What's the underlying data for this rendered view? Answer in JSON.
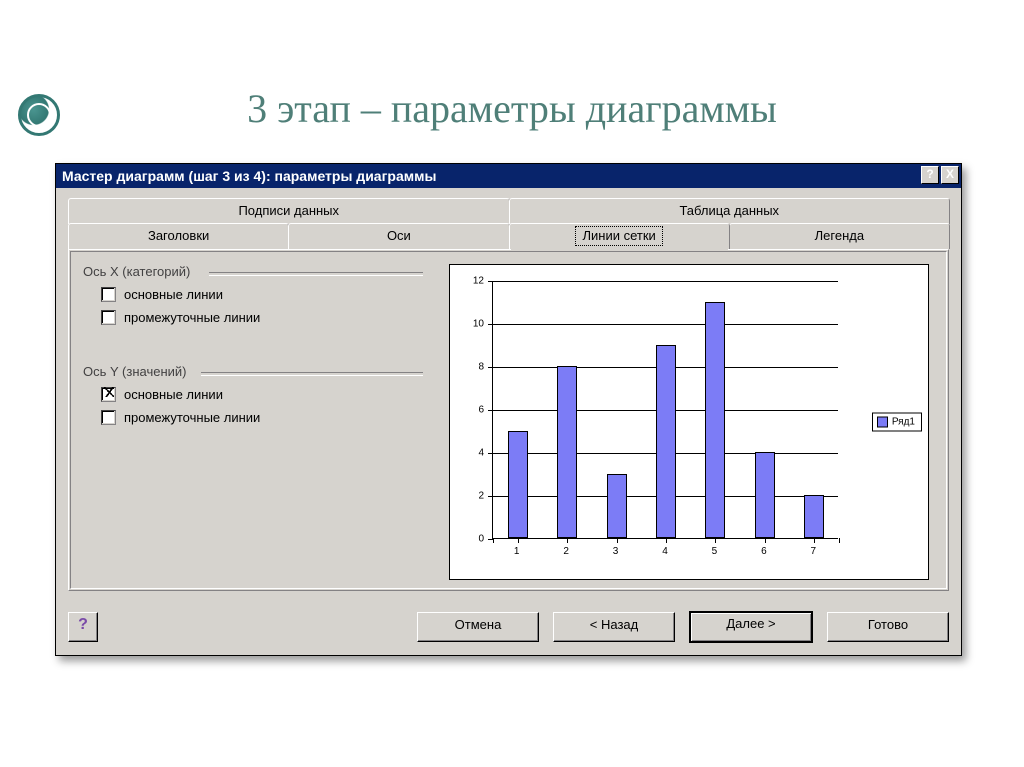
{
  "slide": {
    "title": "3 этап – параметры диаграммы"
  },
  "dialog": {
    "title": "Мастер диаграмм (шаг 3 из 4): параметры диаграммы",
    "help_glyph": "?",
    "close_glyph": "X",
    "tabs_back": [
      "Подписи данных",
      "Таблица данных"
    ],
    "tabs_front": [
      "Заголовки",
      "Оси",
      "Линии сетки",
      "Легенда"
    ],
    "group_x": {
      "title": "Ось X (категорий)",
      "cb_major": "основные линии",
      "cb_minor": "промежуточные линии"
    },
    "group_y": {
      "title": "Ось Y (значений)",
      "cb_major": "основные линии",
      "cb_minor": "промежуточные линии"
    },
    "buttons": {
      "help": "?",
      "cancel": "Отмена",
      "back": "< Назад",
      "next": "Далее >",
      "finish": "Готово"
    }
  },
  "chart_data": {
    "type": "bar",
    "categories": [
      "1",
      "2",
      "3",
      "4",
      "5",
      "6",
      "7"
    ],
    "values": [
      5,
      8,
      3,
      9,
      11,
      4,
      2
    ],
    "legend": "Ряд1",
    "ylim": [
      0,
      12
    ],
    "ytick": 2,
    "xlabel": "",
    "ylabel": "",
    "title": ""
  }
}
